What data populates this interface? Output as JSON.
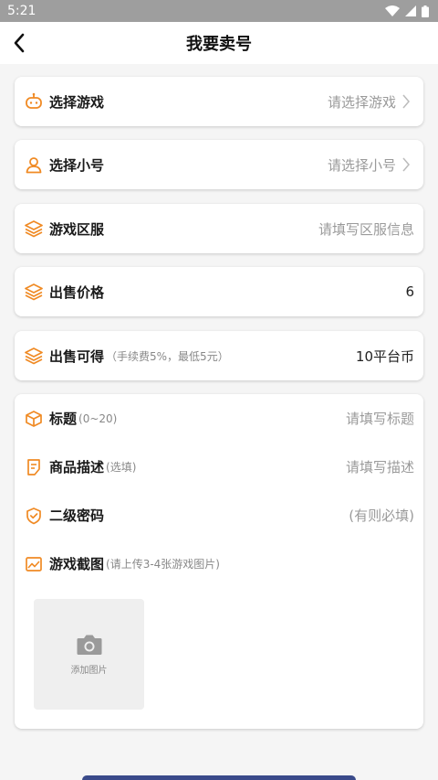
{
  "status": {
    "time": "5:21"
  },
  "header": {
    "title": "我要卖号"
  },
  "rows": {
    "game": {
      "label": "选择游戏",
      "placeholder": "请选择游戏"
    },
    "account": {
      "label": "选择小号",
      "placeholder": "请选择小号"
    },
    "server": {
      "label": "游戏区服",
      "placeholder": "请填写区服信息"
    },
    "price": {
      "label": "出售价格",
      "value": "6"
    },
    "earn": {
      "label": "出售可得",
      "hint": "（手续费5%，最低5元）",
      "value": "10平台币"
    }
  },
  "details": {
    "title": {
      "label": "标题",
      "hint": "(0~20)",
      "placeholder": "请填写标题"
    },
    "desc": {
      "label": "商品描述",
      "hint": "(选填)",
      "placeholder": "请填写描述"
    },
    "password": {
      "label": "二级密码",
      "placeholder": "(有则必填)"
    },
    "screens": {
      "label": "游戏截图",
      "hint": "(请上传3-4张游戏图片)"
    },
    "upload_label": "添加图片"
  },
  "colors": {
    "accent": "#f08a24",
    "status_bar": "#9e9e9e"
  }
}
